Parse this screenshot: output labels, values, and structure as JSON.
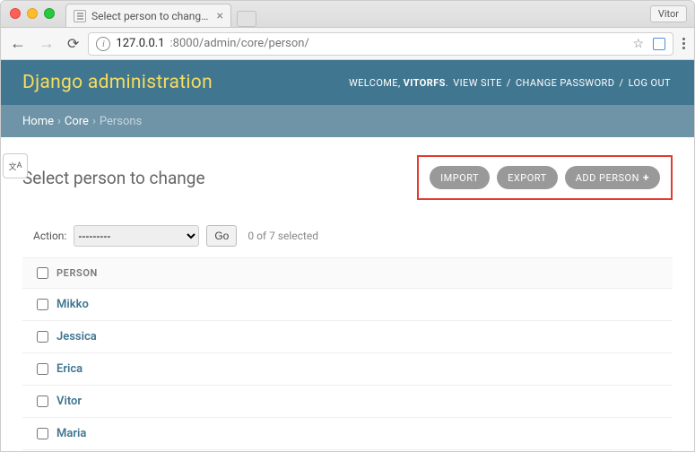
{
  "browser": {
    "tab_title": "Select person to change | Djan",
    "profile": "Vitor",
    "url_host": "127.0.0.1",
    "url_path": ":8000/admin/core/person/"
  },
  "header": {
    "site_title": "Django administration",
    "welcome_prefix": "WELCOME, ",
    "username": "VITORFS",
    "view_site": "VIEW SITE",
    "change_password": "CHANGE PASSWORD",
    "log_out": "LOG OUT"
  },
  "breadcrumbs": {
    "home": "Home",
    "app": "Core",
    "model": "Persons"
  },
  "changelist": {
    "title": "Select person to change",
    "buttons": {
      "import": "IMPORT",
      "export": "EXPORT",
      "add": "ADD PERSON"
    },
    "action_label": "Action:",
    "action_placeholder": "---------",
    "go_label": "Go",
    "selection_status": "0 of 7 selected",
    "column_header": "PERSON",
    "rows": [
      {
        "name": "Mikko"
      },
      {
        "name": "Jessica"
      },
      {
        "name": "Erica"
      },
      {
        "name": "Vitor"
      },
      {
        "name": "Maria"
      }
    ]
  }
}
